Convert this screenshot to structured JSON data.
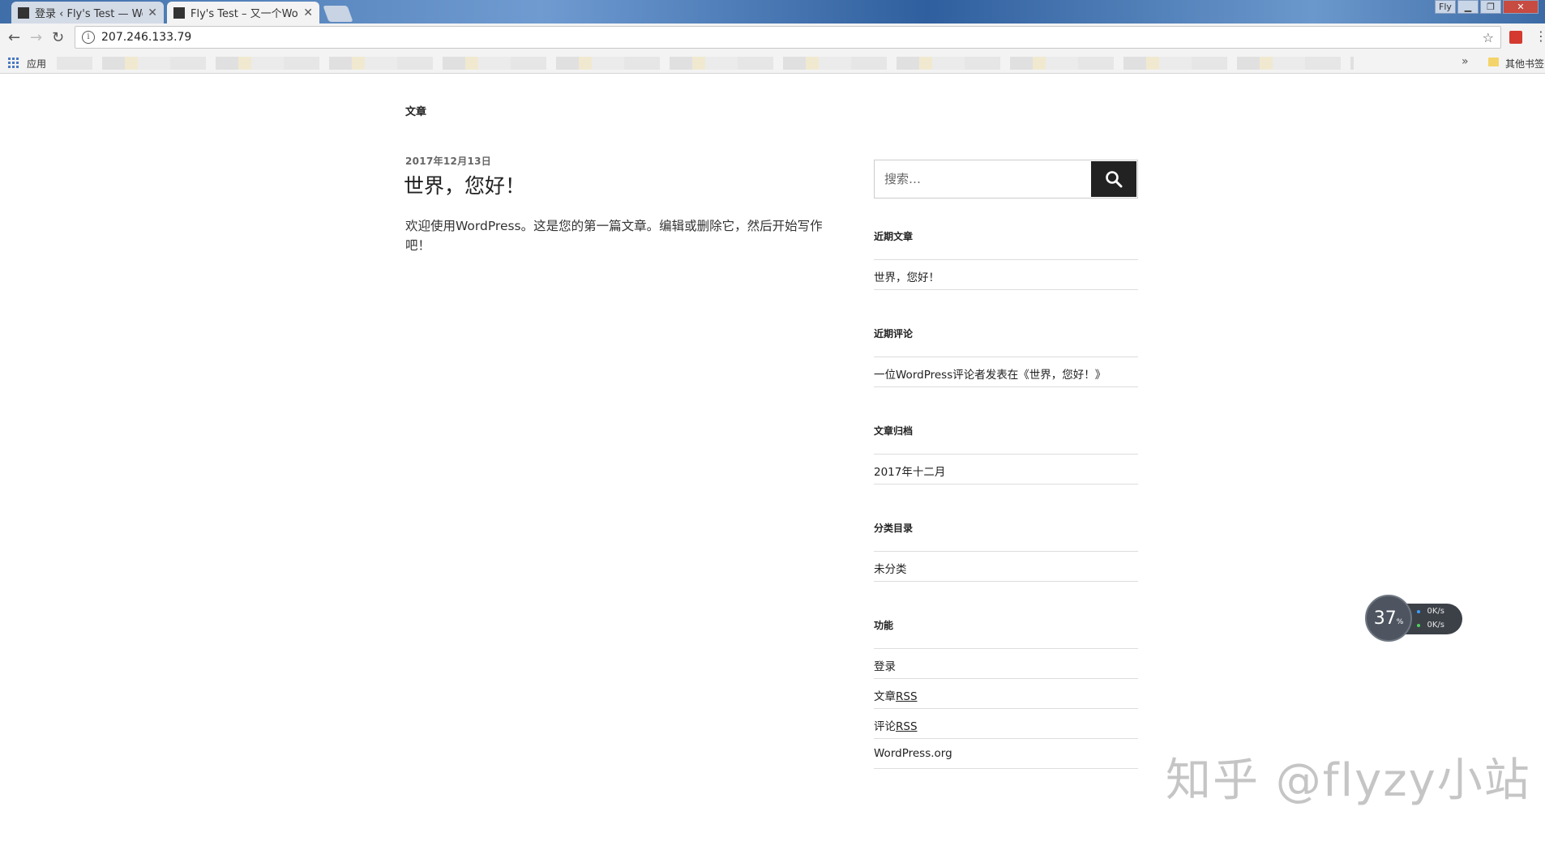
{
  "browser": {
    "tabs": [
      {
        "title": "登录 ‹ Fly's Test — Wor",
        "active": false
      },
      {
        "title": "Fly's Test – 又一个Word",
        "active": true
      }
    ],
    "window_badge": "Fly",
    "address": "207.246.133.79",
    "bookmarks": {
      "apps_label": "应用",
      "more_label": "»",
      "other_label": "其他书签"
    }
  },
  "page": {
    "header_title": "文章",
    "post": {
      "date": "2017年12月13日",
      "title": "世界，您好！",
      "body": "欢迎使用WordPress。这是您的第一篇文章。编辑或删除它，然后开始写作吧！"
    },
    "sidebar": {
      "search_placeholder": "搜索…",
      "widgets": [
        {
          "title": "近期文章",
          "items": [
            "世界，您好！"
          ]
        },
        {
          "title": "近期评论",
          "items": [
            "一位WordPress评论者发表在《世界，您好！》"
          ]
        },
        {
          "title": "文章归档",
          "items": [
            "2017年十二月"
          ]
        },
        {
          "title": "分类目录",
          "items": [
            "未分类"
          ]
        },
        {
          "title": "功能",
          "items": [
            "登录",
            "文章RSS",
            "评论RSS",
            "WordPress.org"
          ]
        }
      ]
    }
  },
  "speed_widget": {
    "percent": "37",
    "percent_unit": "%",
    "upload": "0K/s",
    "download": "0K/s",
    "upload_color": "#3aa0ff",
    "download_color": "#4cd35a"
  },
  "watermark": "知乎 @flyzy小站"
}
